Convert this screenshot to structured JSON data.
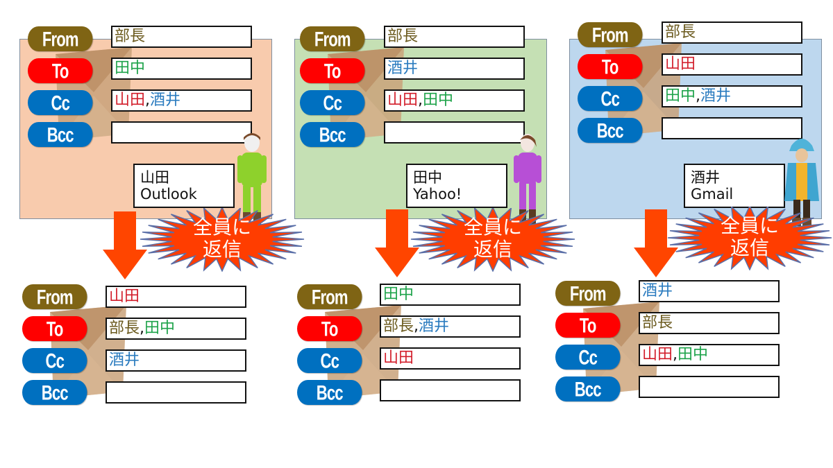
{
  "colors": {
    "from_pill": "#7f6414",
    "to_pill": "#ff0000",
    "cc_pill": "#0070c0",
    "bcc_pill": "#0070c0",
    "name_bucho": "#6b5a1e",
    "name_yamada": "#d21d2a",
    "name_tanaka": "#1ea34a",
    "name_sakai": "#2a7bbf",
    "panel_yamada": "#f8cbad",
    "panel_tanaka": "#c5e0b4",
    "panel_sakai": "#bdd7ee",
    "arrow": "#ff4500",
    "burst": "#ff3d00"
  },
  "labels": {
    "from": "From",
    "to": "To",
    "cc": "Cc",
    "bcc": "Bcc",
    "reply_all_line1": "全員に",
    "reply_all_line2": "返信"
  },
  "scenarios": [
    {
      "recipient": "山田",
      "client": "Outlook",
      "received": {
        "from": [
          {
            "name": "部長",
            "color": "bucho"
          }
        ],
        "to": [
          {
            "name": "田中",
            "color": "tanaka"
          }
        ],
        "cc": [
          {
            "name": "山田",
            "color": "yamada"
          },
          {
            "name": "酒井",
            "color": "sakai"
          }
        ],
        "bcc": []
      },
      "reply": {
        "from": [
          {
            "name": "山田",
            "color": "yamada"
          }
        ],
        "to": [
          {
            "name": "部長",
            "color": "bucho"
          },
          {
            "name": "田中",
            "color": "tanaka"
          }
        ],
        "cc": [
          {
            "name": "酒井",
            "color": "sakai"
          }
        ],
        "bcc": []
      }
    },
    {
      "recipient": "田中",
      "client": "Yahoo!",
      "received": {
        "from": [
          {
            "name": "部長",
            "color": "bucho"
          }
        ],
        "to": [
          {
            "name": "酒井",
            "color": "sakai"
          }
        ],
        "cc": [
          {
            "name": "山田",
            "color": "yamada"
          },
          {
            "name": "田中",
            "color": "tanaka"
          }
        ],
        "bcc": []
      },
      "reply": {
        "from": [
          {
            "name": "田中",
            "color": "tanaka"
          }
        ],
        "to": [
          {
            "name": "部長",
            "color": "bucho"
          },
          {
            "name": "酒井",
            "color": "sakai"
          }
        ],
        "cc": [
          {
            "name": "山田",
            "color": "yamada"
          }
        ],
        "bcc": []
      }
    },
    {
      "recipient": "酒井",
      "client": "Gmail",
      "received": {
        "from": [
          {
            "name": "部長",
            "color": "bucho"
          }
        ],
        "to": [
          {
            "name": "山田",
            "color": "yamada"
          }
        ],
        "cc": [
          {
            "name": "田中",
            "color": "tanaka"
          },
          {
            "name": "酒井",
            "color": "sakai"
          }
        ],
        "bcc": []
      },
      "reply": {
        "from": [
          {
            "name": "酒井",
            "color": "sakai"
          }
        ],
        "to": [
          {
            "name": "部長",
            "color": "bucho"
          }
        ],
        "cc": [
          {
            "name": "山田",
            "color": "yamada"
          },
          {
            "name": "田中",
            "color": "tanaka"
          }
        ],
        "bcc": []
      }
    }
  ]
}
